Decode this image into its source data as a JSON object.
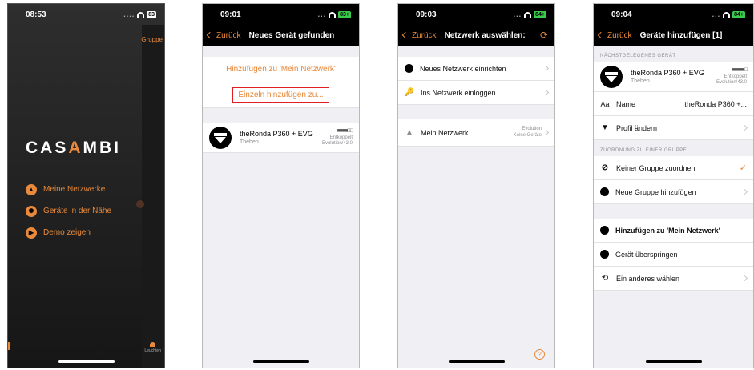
{
  "screens": {
    "home": {
      "time": "08:53",
      "battery": "83",
      "logo": {
        "pre": "CAS",
        "accent": "A",
        "post": "MBI"
      },
      "menu": [
        {
          "label": "Meine Netzwerke",
          "icon": "network-icon"
        },
        {
          "label": "Geräte in der Nähe",
          "icon": "nearby-devices-icon"
        },
        {
          "label": "Demo zeigen",
          "icon": "play-icon"
        }
      ],
      "side_tab": "Gruppe",
      "side_footer": "Leuchten"
    },
    "found": {
      "time": "09:01",
      "battery": "83+",
      "back": "Zurück",
      "title": "Neues Gerät gefunden",
      "add_network": "Hinzufügen zu 'Mein Netzwerk'",
      "add_single": "Einzeln hinzufügen zu...",
      "device": {
        "name": "theRonda P360 + EVG",
        "vendor": "Theben",
        "signal": "■■■■□□",
        "state": "Entkoppelt",
        "firmware": "Evolution/43.0"
      }
    },
    "network": {
      "time": "09:03",
      "battery": "84+",
      "back": "Zurück",
      "title": "Netzwerk auswählen:",
      "new_network": "Neues Netzwerk einrichten",
      "login": "Ins Netzwerk einloggen",
      "my_network": "Mein Netzwerk",
      "my_network_type": "Evolution",
      "my_network_count": "Keine Geräte"
    },
    "add": {
      "time": "09:04",
      "battery": "84+",
      "back": "Zurück",
      "title": "Geräte hinzufügen [1]",
      "nearest_label": "NÄCHSTGELEGENES GERÄT",
      "device": {
        "name": "theRonda P360 + EVG",
        "vendor": "Theben",
        "signal": "■■■■■□",
        "state": "Entkoppelt",
        "firmware": "Evolution/43.0"
      },
      "name_label": "Name",
      "name_prefix": "Aa",
      "name_value": "theRonda P360 +...",
      "profile": "Profil ändern",
      "group_label": "ZUORDNUNG ZU EINER GRUPPE",
      "no_group": "Keiner Gruppe zuordnen",
      "new_group": "Neue Gruppe hinzufügen",
      "add_to": "Hinzufügen zu 'Mein Netzwerk'",
      "skip": "Gerät überspringen",
      "choose_other": "Ein anderes wählen"
    }
  },
  "colors": {
    "accent": "#e8893b",
    "highlight": "#e02020"
  }
}
